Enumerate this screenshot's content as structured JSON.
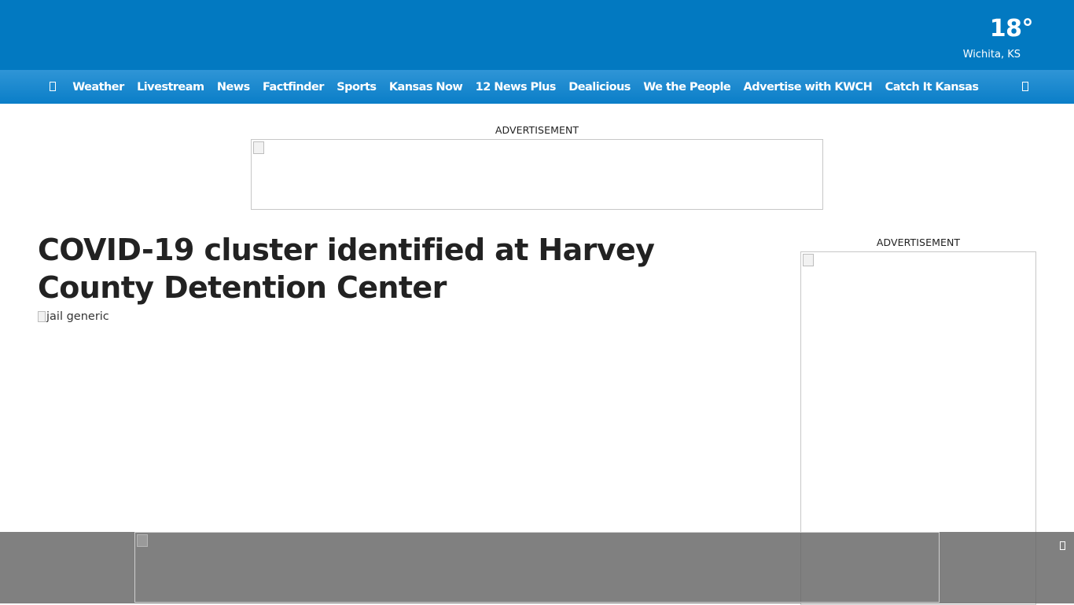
{
  "weather": {
    "temperature": "18°",
    "location": "Wichita, KS"
  },
  "nav": {
    "menu_icon": "hamburger-menu-icon",
    "search_icon": "search-icon",
    "items": [
      {
        "label": "Weather"
      },
      {
        "label": "Livestream"
      },
      {
        "label": "News"
      },
      {
        "label": "Factfinder"
      },
      {
        "label": "Sports"
      },
      {
        "label": "Kansas Now"
      },
      {
        "label": "12 News Plus"
      },
      {
        "label": "Dealicious"
      },
      {
        "label": "We the People"
      },
      {
        "label": "Advertise with KWCH"
      },
      {
        "label": "Catch It Kansas"
      }
    ]
  },
  "ads": {
    "top_label": "ADVERTISEMENT",
    "side_label": "ADVERTISEMENT"
  },
  "article": {
    "title": "COVID-19 cluster identified at Harvey County Detention Center",
    "image_alt": "jail generic"
  },
  "sticky_ad": {
    "close_icon": "close-icon"
  },
  "colors": {
    "header_blue": "#0279c1",
    "nav_blue": "#1b88cf",
    "overlay_gray": "#808080"
  }
}
